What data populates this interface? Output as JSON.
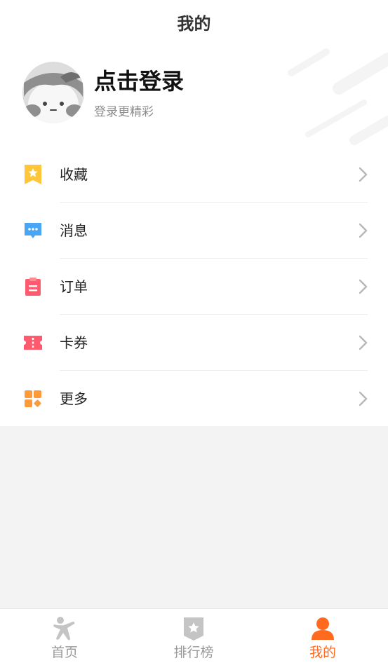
{
  "header": {
    "title": "我的"
  },
  "profile": {
    "login_title": "点击登录",
    "login_sub": "登录更精彩"
  },
  "menu": {
    "items": [
      {
        "label": "收藏",
        "icon": "favorite-icon",
        "color": "#ffc63a"
      },
      {
        "label": "消息",
        "icon": "message-icon",
        "color": "#4aa6f5"
      },
      {
        "label": "订单",
        "icon": "order-icon",
        "color": "#ff5b6e"
      },
      {
        "label": "卡券",
        "icon": "coupon-icon",
        "color": "#ff5b6e"
      },
      {
        "label": "更多",
        "icon": "more-grid-icon",
        "color": "#ff9a3a"
      }
    ]
  },
  "tabbar": {
    "tabs": [
      {
        "label": "首页",
        "icon": "home-icon"
      },
      {
        "label": "排行榜",
        "icon": "ranking-icon"
      },
      {
        "label": "我的",
        "icon": "user-icon",
        "active": true
      }
    ]
  },
  "colors": {
    "accent": "#ff6a1f",
    "inactive": "#999999",
    "arrow": "#b8b8b8"
  }
}
